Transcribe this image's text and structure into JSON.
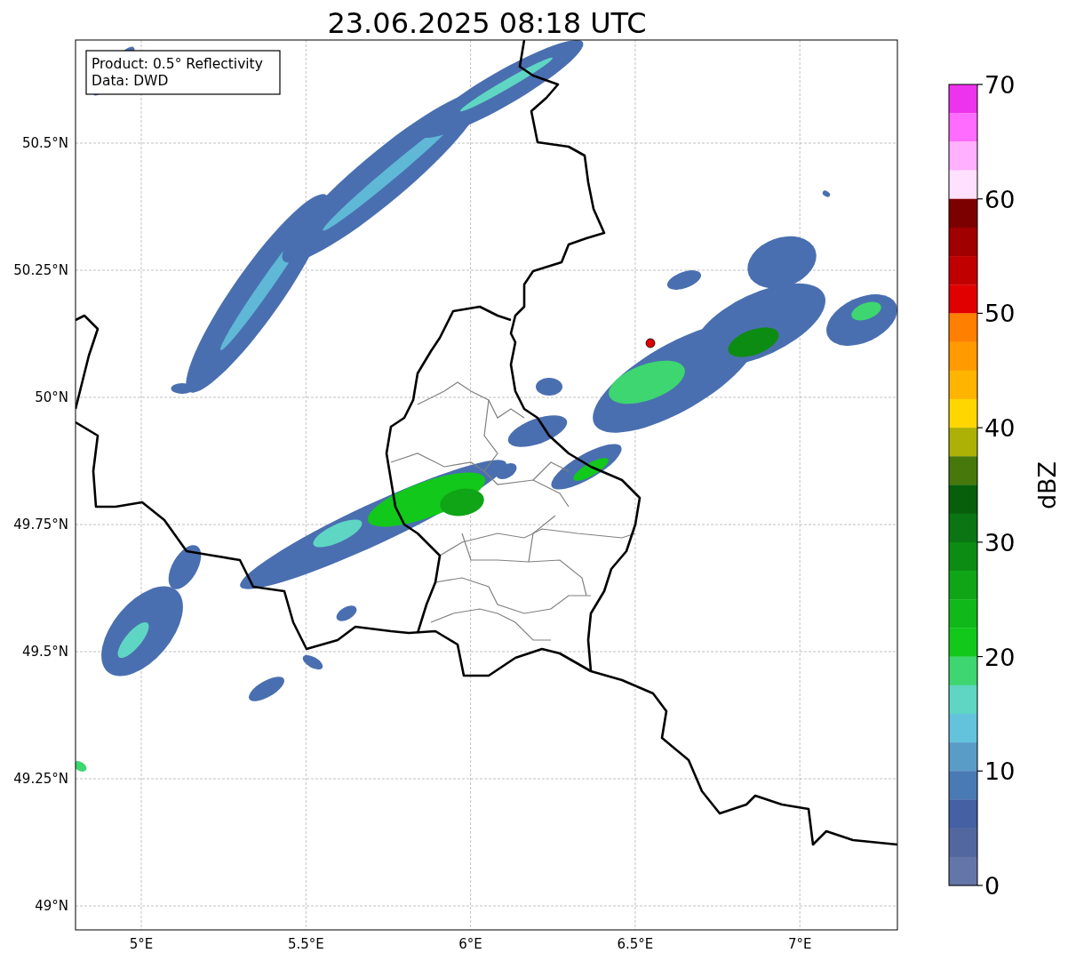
{
  "title": "23.06.2025 08:18 UTC",
  "map": {
    "info_box": [
      "Product: 0.5° Reflectivity",
      "Data: DWD"
    ],
    "lat_ticks": [
      "50.5°N",
      "50.25°N",
      "50°N",
      "49.75°N",
      "49.5°N",
      "49.25°N",
      "49°N"
    ],
    "lon_ticks": [
      "5°E",
      "5.5°E",
      "6°E",
      "6.5°E",
      "7°E"
    ]
  },
  "colorbar": {
    "label": "dBZ",
    "ticks": [
      "70",
      "60",
      "50",
      "40",
      "30",
      "20",
      "10",
      "0"
    ],
    "bands": [
      {
        "color": "#ee33ee"
      },
      {
        "color": "#ff6cff"
      },
      {
        "color": "#ffb0ff"
      },
      {
        "color": "#ffe0ff"
      },
      {
        "color": "#7d0000"
      },
      {
        "color": "#a00000"
      },
      {
        "color": "#c00000"
      },
      {
        "color": "#e00000"
      },
      {
        "color": "#ff7f00"
      },
      {
        "color": "#ff9a00"
      },
      {
        "color": "#ffb400"
      },
      {
        "color": "#ffd700"
      },
      {
        "color": "#adb005"
      },
      {
        "color": "#47780b"
      },
      {
        "color": "#075f0c"
      },
      {
        "color": "#0a7512"
      },
      {
        "color": "#0d8c14"
      },
      {
        "color": "#0fa516"
      },
      {
        "color": "#10b81a"
      },
      {
        "color": "#12c81a"
      },
      {
        "color": "#3dd670"
      },
      {
        "color": "#5fd6c4"
      },
      {
        "color": "#64c3dc"
      },
      {
        "color": "#5a9cc8"
      },
      {
        "color": "#4a7ab3"
      },
      {
        "color": "#4560a3"
      },
      {
        "color": "#52679e"
      },
      {
        "color": "#6475a8"
      }
    ]
  }
}
